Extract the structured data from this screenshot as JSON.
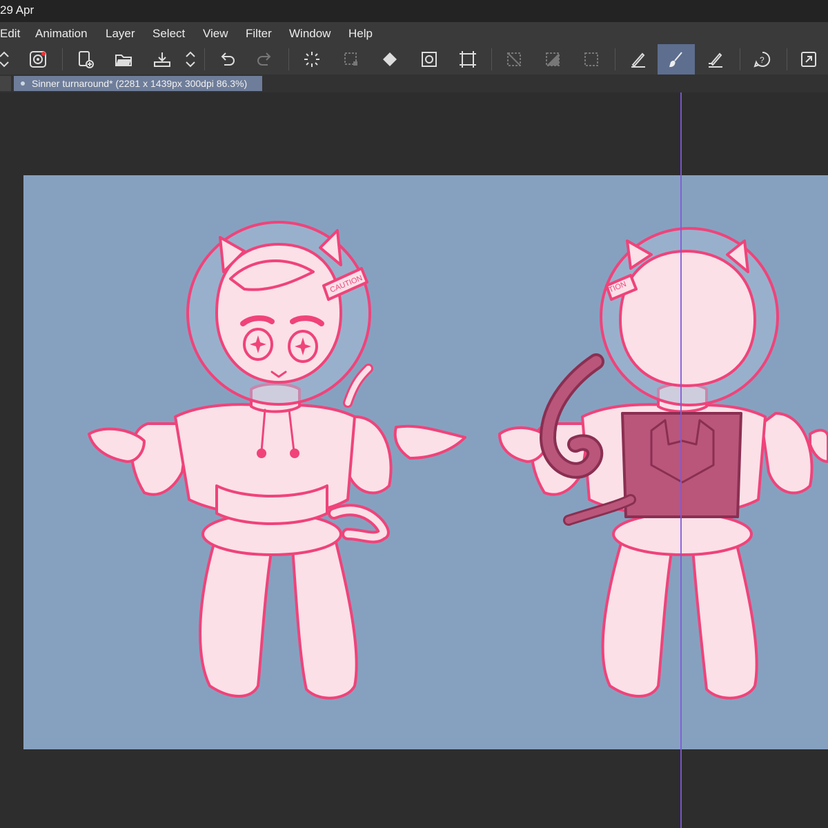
{
  "status": {
    "date": "29 Apr"
  },
  "menu": {
    "items": [
      "Edit",
      "Animation",
      "Layer",
      "Select",
      "View",
      "Filter",
      "Window",
      "Help"
    ]
  },
  "toolbar": {
    "buttons": [
      {
        "icon": "chevron-updown-icon"
      },
      {
        "icon": "app-logo-icon"
      },
      {
        "icon": "new-canvas-icon"
      },
      {
        "icon": "open-folder-icon"
      },
      {
        "icon": "save-icon"
      },
      {
        "icon": "chevron-updown-icon"
      },
      {
        "icon": "undo-icon"
      },
      {
        "icon": "redo-icon"
      },
      {
        "icon": "loading-icon"
      },
      {
        "icon": "selection-icon"
      },
      {
        "icon": "fill-icon"
      },
      {
        "icon": "transform-icon"
      },
      {
        "icon": "crop-icon"
      },
      {
        "icon": "clear-selection-icon"
      },
      {
        "icon": "invert-selection-icon"
      },
      {
        "icon": "select-all-icon"
      },
      {
        "icon": "pen-icon"
      },
      {
        "icon": "brush-icon",
        "active": true
      },
      {
        "icon": "eraser-icon"
      },
      {
        "icon": "help-icon"
      },
      {
        "icon": "fullscreen-icon"
      }
    ]
  },
  "document_tab": {
    "title": "Sinner turnaround* (2281 x 1439px 300dpi 86.3%)"
  },
  "canvas": {
    "background_color": "#86a1c0",
    "line_color": "#f0437a",
    "fill_color": "#fbe0e8",
    "dark_fill_color": "#b95679",
    "caption_front": "CAUTION",
    "caption_back": "TION"
  },
  "colors": {
    "toolbar_bg": "#3a3a3a",
    "active_tool": "#5d6e8f",
    "tab_bg": "#6e7d99",
    "guide": "#7f5ad8"
  }
}
